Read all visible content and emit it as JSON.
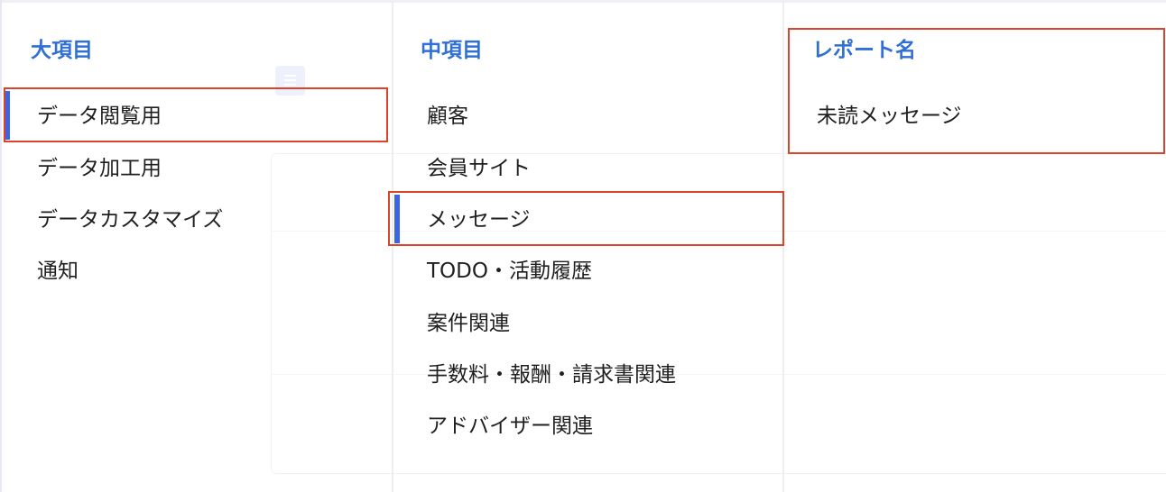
{
  "columns": {
    "major": {
      "header": "大項目",
      "items": [
        {
          "label": "データ閲覧用",
          "selected": true
        },
        {
          "label": "データ加工用",
          "selected": false
        },
        {
          "label": "データカスタマイズ",
          "selected": false
        },
        {
          "label": "通知",
          "selected": false
        }
      ]
    },
    "middle": {
      "header": "中項目",
      "items": [
        {
          "label": "顧客",
          "selected": false
        },
        {
          "label": "会員サイト",
          "selected": false
        },
        {
          "label": "メッセージ",
          "selected": true
        },
        {
          "label": "TODO・活動履歴",
          "selected": false
        },
        {
          "label": "案件関連",
          "selected": false
        },
        {
          "label": "手数料・報酬・請求書関連",
          "selected": false
        },
        {
          "label": "アドバイザー関連",
          "selected": false
        }
      ]
    },
    "report": {
      "header": "レポート名",
      "items": [
        {
          "label": "未読メッセージ",
          "selected": false
        }
      ]
    }
  },
  "colors": {
    "header_text": "#2f6fd6",
    "active_indicator": "#3c66e0",
    "annotation_border": "#d9442b",
    "item_text": "#1f1f1f"
  },
  "icons": {
    "ghost_icon": "list-icon"
  }
}
